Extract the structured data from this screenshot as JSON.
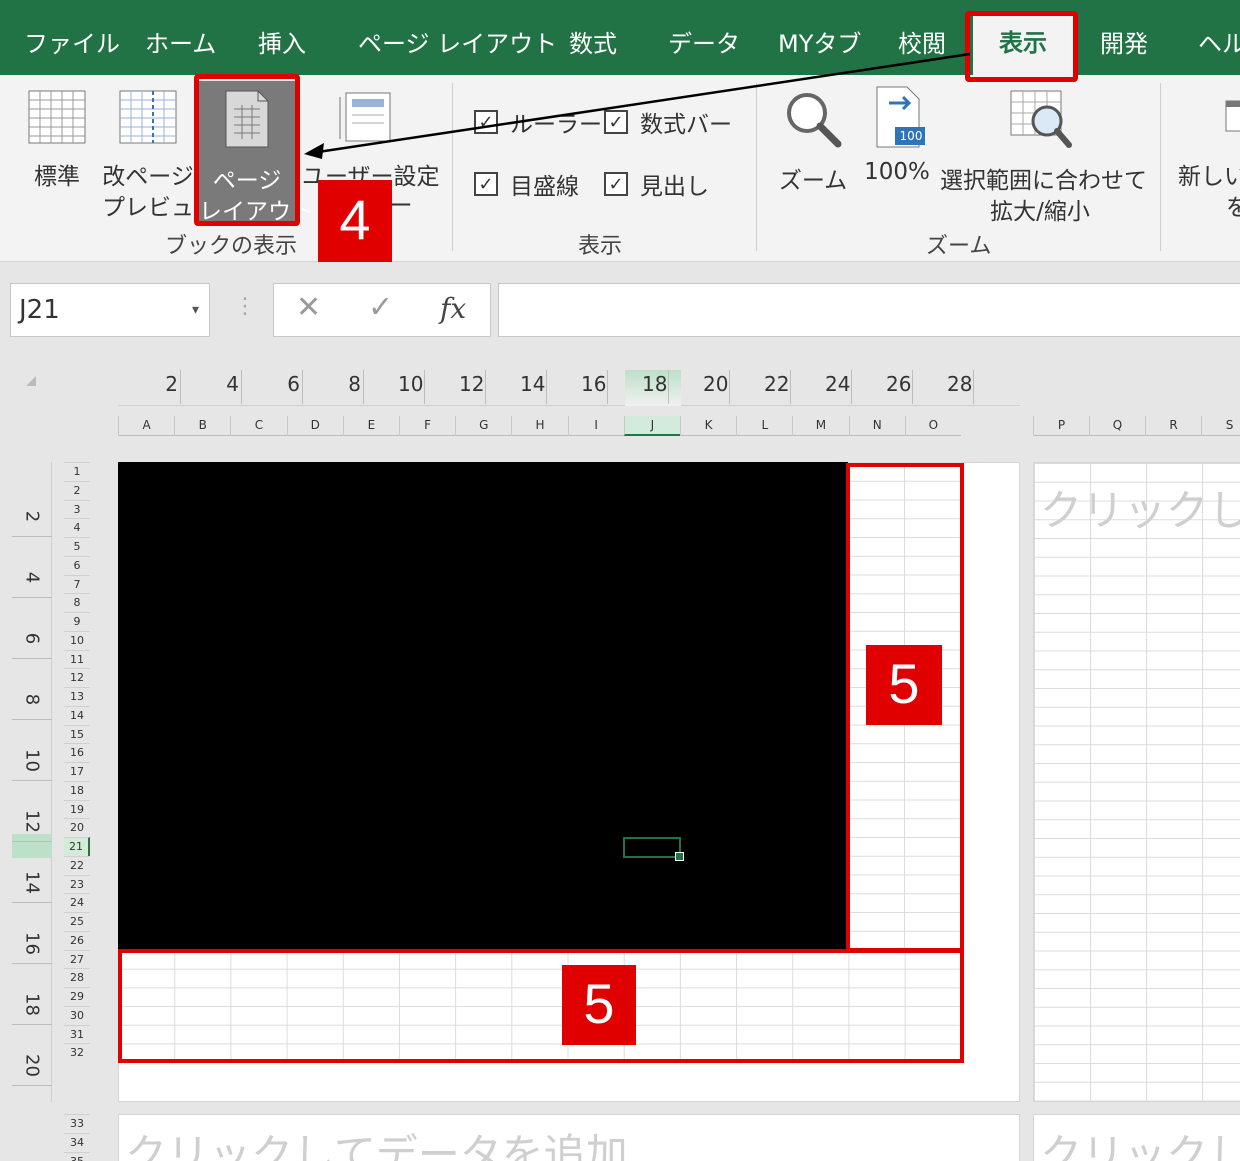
{
  "tabs": [
    {
      "label": "ファイル"
    },
    {
      "label": "ホーム"
    },
    {
      "label": "挿入"
    },
    {
      "label": "ページ レイアウト"
    },
    {
      "label": "数式"
    },
    {
      "label": "データ"
    },
    {
      "label": "MYタブ"
    },
    {
      "label": "校閲"
    },
    {
      "label": "表示"
    },
    {
      "label": "開発"
    },
    {
      "label": "ヘル"
    }
  ],
  "ribbon": {
    "book_view": {
      "group_label": "ブックの表示",
      "normal": "標準",
      "page_break_1": "改ページ",
      "page_break_2": "プレビュー",
      "page_layout_1": "ページ",
      "page_layout_2": "レイアウト",
      "custom": "ユーザー設定",
      "custom_2": "ー"
    },
    "show": {
      "group_label": "表示",
      "ruler": "ルーラー",
      "formula_bar": "数式バー",
      "gridlines": "目盛線",
      "headings": "見出し",
      "check": "✓"
    },
    "zoom": {
      "group_label": "ズーム",
      "zoom": "ズーム",
      "zoom100": "100%",
      "zoom_icon_text": "100",
      "fit_1": "選択範囲に合わせて",
      "fit_2": "拡大/縮小"
    },
    "window": {
      "new_1": "新しい",
      "new_2": "を"
    }
  },
  "annotations": {
    "step4": "4",
    "step5a": "5",
    "step5b": "5"
  },
  "formula_bar": {
    "name_box": "J21",
    "dropdown": "▾",
    "cancel": "✕",
    "enter": "✓",
    "fx": "fx",
    "divider": "⋮",
    "value": ""
  },
  "ruler_top": [
    "2",
    "4",
    "6",
    "8",
    "10",
    "12",
    "14",
    "16",
    "18",
    "20",
    "22",
    "24",
    "26",
    "28"
  ],
  "columns": [
    "A",
    "B",
    "C",
    "D",
    "E",
    "F",
    "G",
    "H",
    "I",
    "J",
    "K",
    "L",
    "M",
    "N",
    "O"
  ],
  "columns_right": [
    "P",
    "Q",
    "R",
    "S"
  ],
  "rows": [
    "1",
    "2",
    "3",
    "4",
    "5",
    "6",
    "7",
    "8",
    "9",
    "10",
    "11",
    "12",
    "13",
    "14",
    "15",
    "16",
    "17",
    "18",
    "19",
    "20",
    "21",
    "22",
    "23",
    "24",
    "25",
    "26",
    "27",
    "28",
    "29",
    "30",
    "31",
    "32"
  ],
  "rows_bottom": [
    "33",
    "34",
    "35"
  ],
  "ruler_left": [
    "2",
    "4",
    "6",
    "8",
    "10",
    "12",
    "14",
    "16",
    "18",
    "20"
  ],
  "placeholder": {
    "right_page": "クリックしてデ",
    "bottom_page": "クリックしてデータを追加",
    "bottom_right": "クリックしてデ"
  }
}
